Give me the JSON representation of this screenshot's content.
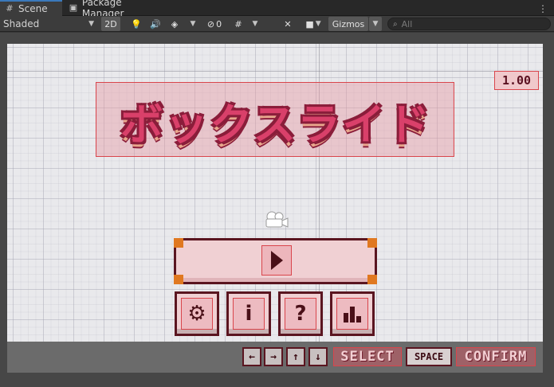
{
  "tabs": [
    {
      "label": "Scene",
      "icon": "hash-icon",
      "active": true
    },
    {
      "label": "Package Manager",
      "icon": "package-icon",
      "active": false
    }
  ],
  "toolbar": {
    "shading_mode": "Shaded",
    "mode_2d": "2D",
    "hidden_count": "0",
    "gizmos": "Gizmos",
    "search_placeholder": "All"
  },
  "game": {
    "title": "ボックスライド",
    "version": "1.00",
    "menu_buttons": [
      {
        "name": "settings",
        "glyph": "⚙"
      },
      {
        "name": "info",
        "glyph": "i"
      },
      {
        "name": "help",
        "glyph": "?"
      },
      {
        "name": "stats",
        "glyph": "▮"
      }
    ],
    "keys": [
      "←",
      "→",
      "↑",
      "↓"
    ],
    "select_label": "SELECT",
    "space_label": "SPACE",
    "confirm_label": "CONFIRM"
  },
  "colors": {
    "title_fill": "#d9406a",
    "title_outline": "#8a1d3a",
    "button_bg": "#f0d0d3",
    "button_border": "#5a1520",
    "corner_accent": "#e07820",
    "selection_outline": "#d9454c"
  }
}
